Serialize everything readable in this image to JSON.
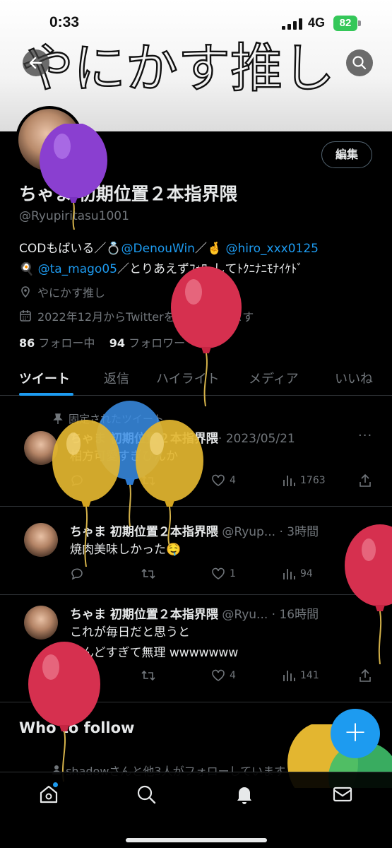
{
  "status_bar": {
    "time": "0:33",
    "network": "4G",
    "battery": "82"
  },
  "header": {
    "banner_text": "やにかす推し"
  },
  "profile": {
    "display_name": "ちゃま 初期位置２本指界隈",
    "handle": "@Ryupiritasu1001",
    "edit_label": "編集",
    "bio_line1_prefix": "CODもばいる／",
    "bio_mention1": "@DenouWin",
    "bio_sep": "／",
    "bio_mention2": "@hiro_xxx0125",
    "bio_mention3": "@ta_mago05",
    "bio_line2_suffix": "／とりあえずﾌｫﾛｰしてﾄｸﾆﾅﾆﾓﾅｲｹﾄﾞ",
    "location": "やにかす推し",
    "joined": "2022年12月からTwitterを利用しています",
    "following_count": "86",
    "following_label": "フォロー中",
    "followers_count": "94",
    "followers_label": "フォロワー"
  },
  "tabs": [
    "ツイート",
    "返信",
    "ハイライト",
    "メディア",
    "いいね"
  ],
  "pinned_label": "固定されたツイート",
  "tweets": [
    {
      "name": "ちゃま 初期位置２本指界隈",
      "sub": "· 2023/05/21",
      "lines": [
        "相方可愛すぎひんか"
      ],
      "reply": "",
      "retweet": "",
      "like": "4",
      "views": "1763"
    },
    {
      "name": "ちゃま 初期位置２本指界隈",
      "sub": " @Ryup... · 3時間",
      "lines": [
        "焼肉美味しかった🤤"
      ],
      "reply": "",
      "retweet": "",
      "like": "1",
      "views": "94"
    },
    {
      "name": "ちゃま 初期位置２本指界隈",
      "sub": " @Ryu... · 16時間",
      "lines": [
        "これが毎日だと思うと",
        "しんどすぎて無理 wwwwwww"
      ],
      "reply": "",
      "retweet": "",
      "like": "4",
      "views": "141"
    }
  ],
  "who_to_follow": "Who to follow",
  "suggestion_text": "shadowさんと他3人がフォローしています",
  "fab_label": "+",
  "colors": {
    "accent": "#1d9bf0",
    "background": "#000000",
    "muted": "#71767b"
  }
}
